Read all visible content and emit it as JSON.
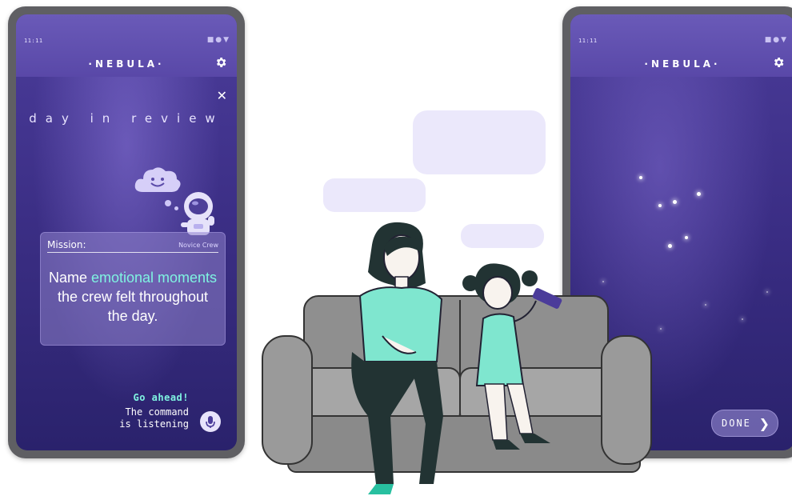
{
  "left_phone": {
    "status_time": "11:11",
    "brand": "·NEBULA·",
    "review_title": "day in review",
    "mission": {
      "label": "Mission:",
      "crew": "Novice Crew",
      "text_part1": "Name ",
      "text_highlight": "emotional moments",
      "text_part2": " the crew felt throughout the day."
    },
    "prompt_go": "Go ahead!",
    "prompt_line1": "The command",
    "prompt_line2": "is listening"
  },
  "right_phone": {
    "status_time": "11:11",
    "brand": "·NEBULA·",
    "done_label": "DONE"
  },
  "colors": {
    "accent": "#7ff3e1",
    "header": "#5948a8",
    "screen_dark": "#2a226c",
    "bubble": "#ebe8fb",
    "sofa": "#9a9a9a"
  }
}
